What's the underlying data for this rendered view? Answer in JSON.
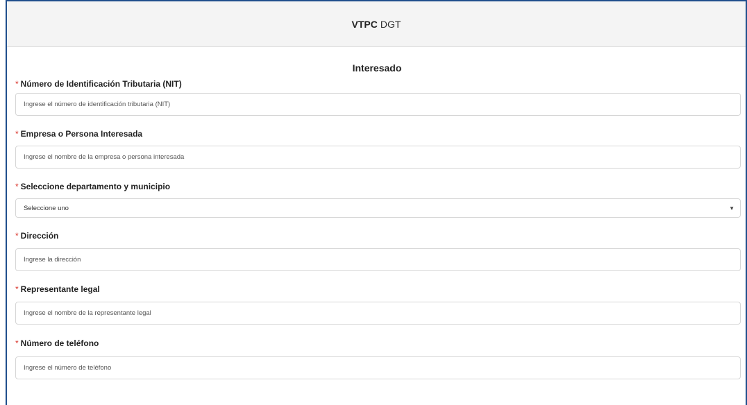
{
  "header": {
    "brand": "VTPC",
    "subtitle": "DGT"
  },
  "section": {
    "title": "Interesado"
  },
  "fields": [
    {
      "label": "Número de Identificación Tributaria (NIT)",
      "placeholder": "Ingrese el número de identificación tributaria (NIT)"
    },
    {
      "label": "Empresa o Persona Interesada",
      "placeholder": "Ingrese el nombre de la empresa o persona interesada"
    },
    {
      "label": "Seleccione departamento y municipio",
      "placeholder": "Seleccione uno"
    },
    {
      "label": "Dirección",
      "placeholder": "Ingrese la dirección"
    },
    {
      "label": "Representante legal",
      "placeholder": "Ingrese el nombre de la representante legal"
    },
    {
      "label": "Número de teléfono",
      "placeholder": "Ingrese el número de teléfono"
    }
  ],
  "required_marker": "*",
  "colors": {
    "frame_border": "#1f4e8c",
    "required": "#d9342b",
    "header_bg": "#f4f4f4"
  }
}
